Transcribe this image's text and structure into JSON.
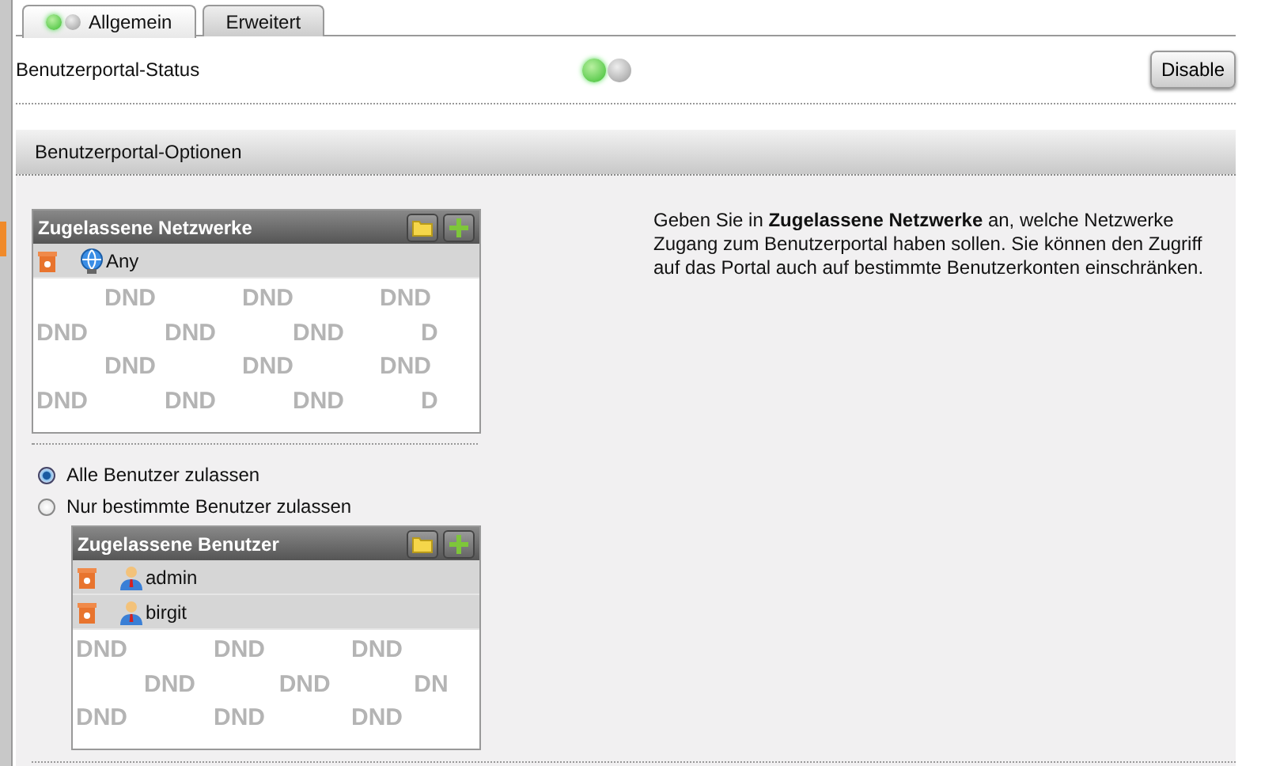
{
  "tabs": [
    {
      "label": "Allgemein",
      "selected": true,
      "indicator": true
    },
    {
      "label": "Erweitert",
      "selected": false,
      "indicator": false
    }
  ],
  "status": {
    "label": "Benutzerportal-Status",
    "on": true,
    "button": "Disable"
  },
  "section": {
    "title": "Benutzerportal-Optionen"
  },
  "networks": {
    "title": "Zugelassene Netzwerke",
    "items": [
      {
        "label": "Any",
        "kind": "network"
      }
    ],
    "pattern": [
      [
        "DND",
        "DND",
        "DND"
      ],
      [
        "DND",
        "DND",
        "DND",
        "D"
      ],
      [
        "DND",
        "DND",
        "DND"
      ],
      [
        "DND",
        "DND",
        "DND",
        "D"
      ]
    ]
  },
  "description": "Geben Sie in **Zugelassene Netzwerke** an, welche Netzwerke Zugang zum Benutzerportal haben sollen. Sie können den Zugriff auf das Portal auch auf bestimmte Benutzerkonten einschränken.",
  "radios": [
    {
      "label": "Alle Benutzer zulassen",
      "selected": true
    },
    {
      "label": "Nur bestimmte Benutzer zulassen",
      "selected": false
    }
  ],
  "users": {
    "title": "Zugelassene Benutzer",
    "items": [
      {
        "label": "admin",
        "kind": "user"
      },
      {
        "label": "birgit",
        "kind": "user"
      }
    ],
    "pattern": [
      [
        "DND",
        "DND",
        "DND"
      ],
      [
        "DND",
        "DND",
        "DN"
      ],
      [
        "DND",
        "DND",
        "DND"
      ]
    ]
  }
}
